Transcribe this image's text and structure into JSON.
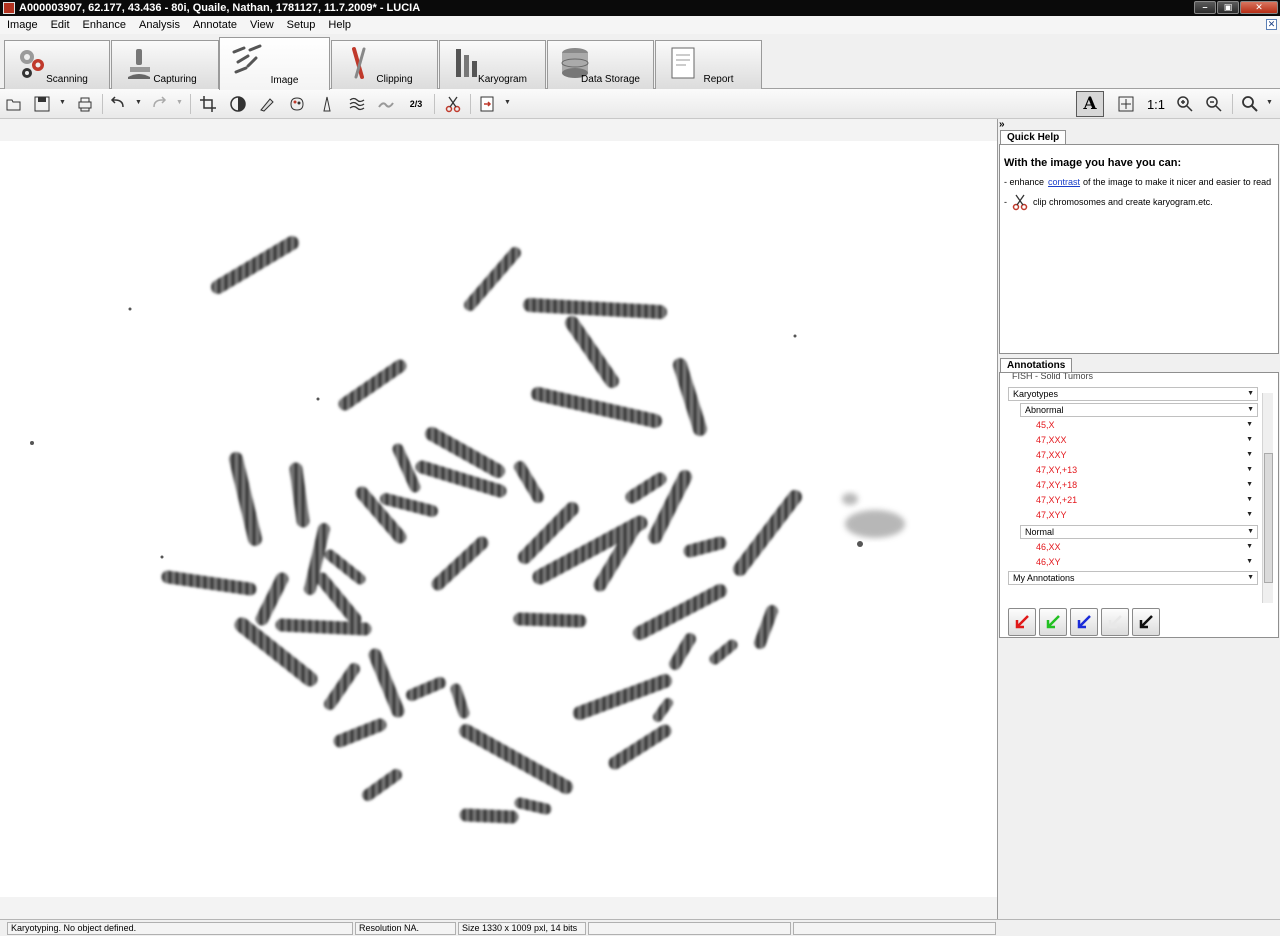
{
  "window": {
    "title": "A000003907, 62.177, 43.436 - 80i, Quaile, Nathan, 1781127, 11.7.2009* - LUCIA"
  },
  "menu": [
    "Image",
    "Edit",
    "Enhance",
    "Analysis",
    "Annotate",
    "View",
    "Setup",
    "Help"
  ],
  "modules": [
    {
      "label": "Scanning",
      "icon": "gears-icon"
    },
    {
      "label": "Capturing",
      "icon": "microscope-icon"
    },
    {
      "label": "Image",
      "icon": "chromosomes-icon",
      "active": true
    },
    {
      "label": "Clipping",
      "icon": "clip-chromosome-icon"
    },
    {
      "label": "Karyogram",
      "icon": "karyogram-icon"
    },
    {
      "label": "Data Storage",
      "icon": "database-icon"
    },
    {
      "label": "Report",
      "icon": "report-icon"
    }
  ],
  "toolbar": {
    "zoom_1to1": "1:1",
    "superscript": "2/3"
  },
  "quick_help": {
    "tab": "Quick Help",
    "toggle": "»",
    "heading": "With the image you have you can:",
    "line1_prefix": "- enhance",
    "line1_link": "contrast",
    "line1_suffix": "of the image to make it nicer and easier to read",
    "line2_prefix": "-",
    "line2_text": "clip chromosomes and create karyogram.etc."
  },
  "annotations": {
    "tab": "Annotations",
    "clipped_top": "FISH - Solid Tumors",
    "karyotypes": "Karyotypes",
    "abnormal": "Abnormal",
    "abnormal_items": [
      "45,X",
      "47,XXX",
      "47,XXY",
      "47,XY,+13",
      "47,XY,+18",
      "47,XY,+21",
      "47,XYY"
    ],
    "normal": "Normal",
    "normal_items": [
      "46,XX",
      "46,XY"
    ],
    "my_annotations": "My Annotations",
    "arrow_colors": [
      "#e01818",
      "#22c022",
      "#1a2bd8",
      "#e8e8e8",
      "#111111"
    ]
  },
  "status": {
    "message": "Karyotyping. No object defined.",
    "resolution": "Resolution NA.",
    "size": "Size 1330 x 1009 pxl, 14 bits"
  }
}
